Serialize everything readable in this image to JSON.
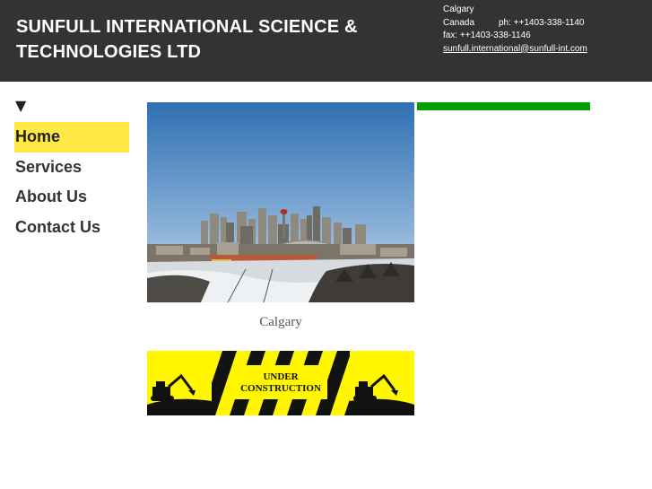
{
  "header": {
    "title": "SUNFULL INTERNATIONAL SCIENCE & TECHNOLOGIES LTD",
    "contact": {
      "city": "Calgary",
      "country": "Canada",
      "phone": "ph: ++1403-338-1140",
      "fax": "fax: ++1403-338-1146",
      "email": "sunfull.international@sunfull-int.com"
    }
  },
  "nav": {
    "toggle_glyph": "▼",
    "items": [
      {
        "label": "Home",
        "active": true
      },
      {
        "label": "Services",
        "active": false
      },
      {
        "label": "About Us",
        "active": false
      },
      {
        "label": "Contact Us",
        "active": false
      }
    ]
  },
  "main": {
    "photo_caption": "Calgary",
    "banner": {
      "line1": "UNDER",
      "line2": "CONSTRUCTION"
    }
  },
  "colors": {
    "header_bg": "#333333",
    "nav_active_bg": "#ffe843",
    "accent_green": "#00a000",
    "banner_yellow": "#fff600"
  }
}
